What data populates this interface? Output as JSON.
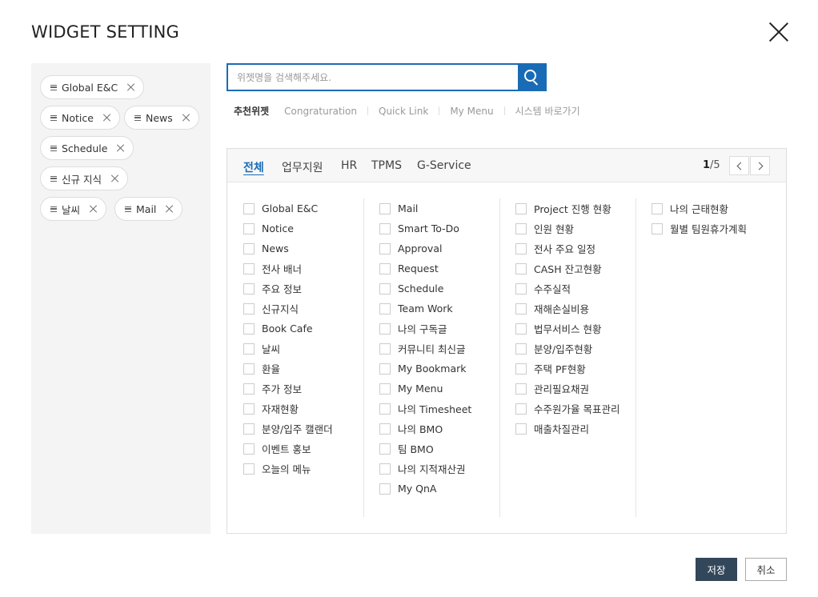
{
  "dialog": {
    "title": "WIDGET SETTING"
  },
  "selected": [
    "Global E&C",
    "Notice",
    "News",
    "Schedule",
    "신규 지식",
    "날씨",
    "Mail"
  ],
  "search": {
    "placeholder": "위젯명을 검색해주세요.",
    "value": ""
  },
  "quick_links": [
    "추천위젯",
    "Congraturation",
    "Quick Link",
    "My Menu",
    "시스템 바로가기"
  ],
  "tabs": [
    "전체",
    "업무지원",
    "HR",
    "TPMS",
    "G-Service"
  ],
  "pager": {
    "current": "1",
    "total": "/5"
  },
  "columns": [
    [
      "Global E&C",
      "Notice",
      "News",
      "전사 배너",
      "주요 정보",
      "신규지식",
      "Book Cafe",
      "날씨",
      "환율",
      "주가 정보",
      "자재현황",
      "분양/입주 캘랜더",
      "이벤트 홍보",
      "오늘의 메뉴"
    ],
    [
      "Mail",
      "Smart To-Do",
      "Approval",
      "Request",
      "Schedule",
      "Team Work",
      "나의 구독글",
      "커뮤니티 최신글",
      "My Bookmark",
      "My Menu",
      "나의 Timesheet",
      "나의 BMO",
      "팀 BMO",
      "나의 지적재산권",
      "My QnA"
    ],
    [
      "Project 진행 현황",
      "인원 현황",
      "전사 주요 일정",
      "CASH 잔고현황",
      "수주실적",
      "재해손실비용",
      "법무서비스 현황",
      "분양/입주현황",
      "주택 PF현황",
      "관리필요채권",
      "수주원가율 목표관리",
      "매출차질관리"
    ],
    [
      "나의 근태현황",
      "월별 팀원휴가계획"
    ]
  ],
  "buttons": {
    "save": "저장",
    "cancel": "취소"
  },
  "colors": {
    "accent": "#1a6bb5",
    "save_bg": "#33475b",
    "panel_bg": "#f4f4f4"
  }
}
